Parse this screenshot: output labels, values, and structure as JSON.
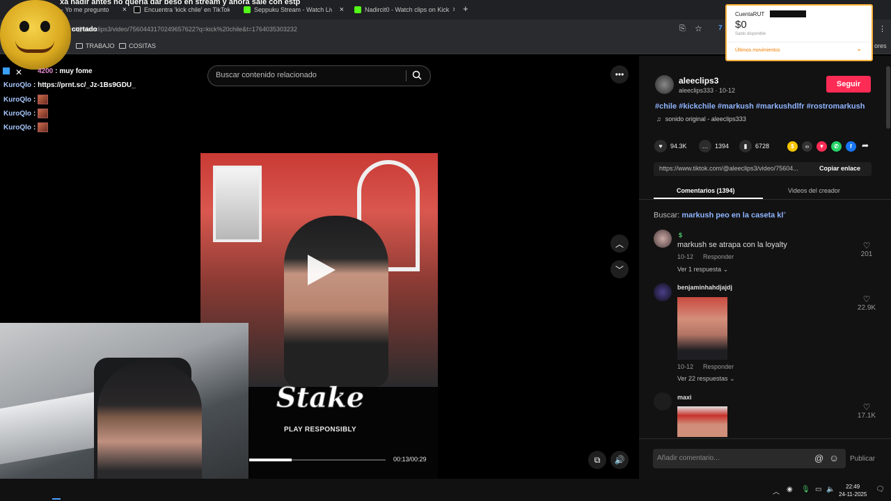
{
  "stream": {
    "title": "xa nadir antes no queria dar beso en stream y ahora sale con estp",
    "overlay_label": "cortado"
  },
  "browser": {
    "tabs": [
      {
        "label": "- Yo me pregunto",
        "color": "#9aa0a6"
      },
      {
        "label": "Encuentra 'kick chile' en TikTok",
        "color": "#111111"
      },
      {
        "label": "Seppuku Stream - Watch Live on Kick",
        "color": "#53fc18"
      },
      {
        "label": "Nadircit0 - Watch clips on Kick",
        "color": "#53fc18"
      }
    ],
    "url": "m/@aleeclips3/video/7560443170249657622?q=kick%20chile&t=1764035303232",
    "bookmarks": [
      "TRABAJO",
      "COSITAS"
    ],
    "bookmarks_right": "ores"
  },
  "chat": [
    {
      "user": "4200",
      "message": ": muy fome",
      "user_color": "#e58bd0"
    },
    {
      "user": "KuroQlo",
      "message": ": https://prnt.sc/_Jz-1Bs9GDU_"
    },
    {
      "user": "KuroQlo",
      "message": ":"
    },
    {
      "user": "KuroQlo",
      "message": ":"
    },
    {
      "user": "KuroQlo",
      "message": ":"
    }
  ],
  "search": {
    "placeholder": "Buscar contenido relacionado"
  },
  "video": {
    "brand": "Stake",
    "tagline": "PLAY RESPONSIBLY",
    "time": "00:13/00:29",
    "progress": 0.31
  },
  "author": {
    "handle": "aleeclips3",
    "username": "aleeclips333",
    "date": "10-12",
    "follow_label": "Seguir"
  },
  "description": {
    "hashtags": "#chile #kickchile #markush #markushdlfr #rostromarkush",
    "sound": "sonido original - aleeclips333"
  },
  "stats": {
    "likes": "94.3K",
    "comments": "1394",
    "saves": "6728"
  },
  "share_icons": [
    {
      "name": "coin-icon",
      "color": "#f5c400",
      "glyph": "$"
    },
    {
      "name": "embed-icon",
      "color": "#333333",
      "glyph": "‹›"
    },
    {
      "name": "send-icon",
      "color": "#fe2c55",
      "glyph": "▼"
    },
    {
      "name": "whatsapp-icon",
      "color": "#25d366",
      "glyph": "✆"
    },
    {
      "name": "facebook-icon",
      "color": "#1877f2",
      "glyph": "f"
    }
  ],
  "link": {
    "url": "https://www.tiktok.com/@aleeclips3/video/75604...",
    "copy_label": "Copiar enlace"
  },
  "tabs": {
    "comments": "Comentarios (1394)",
    "creator_videos": "Videos del creador"
  },
  "suggest": {
    "prefix": "Buscar:",
    "query": "markush peo en la caseta kl"
  },
  "comments": [
    {
      "name": "$",
      "text": "markush se atrapa con la loyalty",
      "date": "10-12",
      "reply": "Responder",
      "replies": "Ver 1 respuesta",
      "likes": "201"
    },
    {
      "name": "benjaminhahdjajdj",
      "text": "",
      "date": "10-12",
      "reply": "Responder",
      "replies": "Ver 22 respuestas",
      "likes": "22.9K"
    },
    {
      "name": "maxi",
      "text": "",
      "date": "",
      "reply": "",
      "replies": "",
      "likes": "17.1K"
    }
  ],
  "comment_input": {
    "placeholder": "Añadir comentario...",
    "publish": "Publicar"
  },
  "bank_popup": {
    "account": "CuentaRUT",
    "balance": "$0",
    "balance_label": "Saldo disponible",
    "movements": "Últimos movimientos"
  },
  "taskbar": {
    "time": "22:49",
    "date": "24-11-2025"
  },
  "colors": {
    "accent": "#fe2c55",
    "link": "#8fb4ff",
    "panel_bg": "#121212"
  }
}
